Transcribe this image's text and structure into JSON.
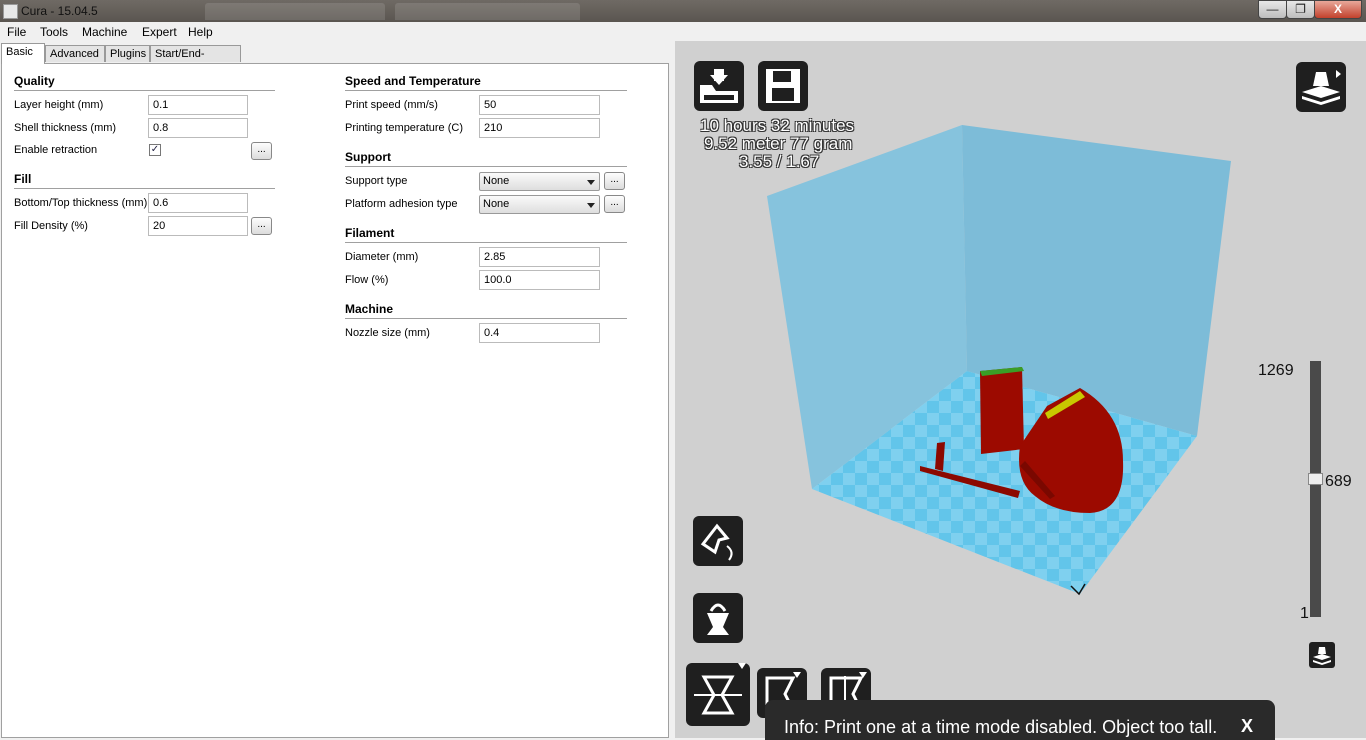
{
  "window": {
    "title": "Cura - 15.04.5",
    "controls": {
      "minimize": "—",
      "maximize": "❐",
      "close": "X"
    }
  },
  "menu": [
    "File",
    "Tools",
    "Machine",
    "Expert",
    "Help"
  ],
  "tabs": [
    "Basic",
    "Advanced",
    "Plugins",
    "Start/End-GCode"
  ],
  "quality": {
    "title": "Quality",
    "layer_height_label": "Layer height (mm)",
    "layer_height_value": "0.1",
    "shell_thickness_label": "Shell thickness (mm)",
    "shell_thickness_value": "0.8",
    "retraction_label": "Enable retraction",
    "retraction_checked": true
  },
  "fill": {
    "title": "Fill",
    "bottom_top_label": "Bottom/Top thickness (mm)",
    "bottom_top_value": "0.6",
    "density_label": "Fill Density (%)",
    "density_value": "20"
  },
  "speed": {
    "title": "Speed and Temperature",
    "print_speed_label": "Print speed (mm/s)",
    "print_speed_value": "50",
    "temp_label": "Printing temperature (C)",
    "temp_value": "210"
  },
  "support": {
    "title": "Support",
    "type_label": "Support type",
    "type_value": "None",
    "adhesion_label": "Platform adhesion type",
    "adhesion_value": "None"
  },
  "filament": {
    "title": "Filament",
    "diameter_label": "Diameter (mm)",
    "diameter_value": "2.85",
    "flow_label": "Flow (%)",
    "flow_value": "100.0"
  },
  "machine": {
    "title": "Machine",
    "nozzle_label": "Nozzle size (mm)",
    "nozzle_value": "0.4"
  },
  "dots_label": "...",
  "print_info": {
    "time": "10 hours 32 minutes",
    "material": "9.52 meter 77 gram",
    "cost": "3.55 / 1.67"
  },
  "layers": {
    "max": "1269",
    "current": "689",
    "min": "1",
    "current_fraction": 0.543
  },
  "info_bar": {
    "message": "Info: Print one at a time mode disabled. Object too tall.",
    "close": "X"
  },
  "icons": [
    "load-icon",
    "save-icon",
    "view-mode-icon",
    "rotate-icon",
    "scale-icon",
    "mirror-icon",
    "layer-view-icon"
  ],
  "colors": {
    "build_volume": "#8ec9e2",
    "platform": "#5fc6ea",
    "model": "#9c0a00",
    "toolbar": "#1f1f1f"
  }
}
